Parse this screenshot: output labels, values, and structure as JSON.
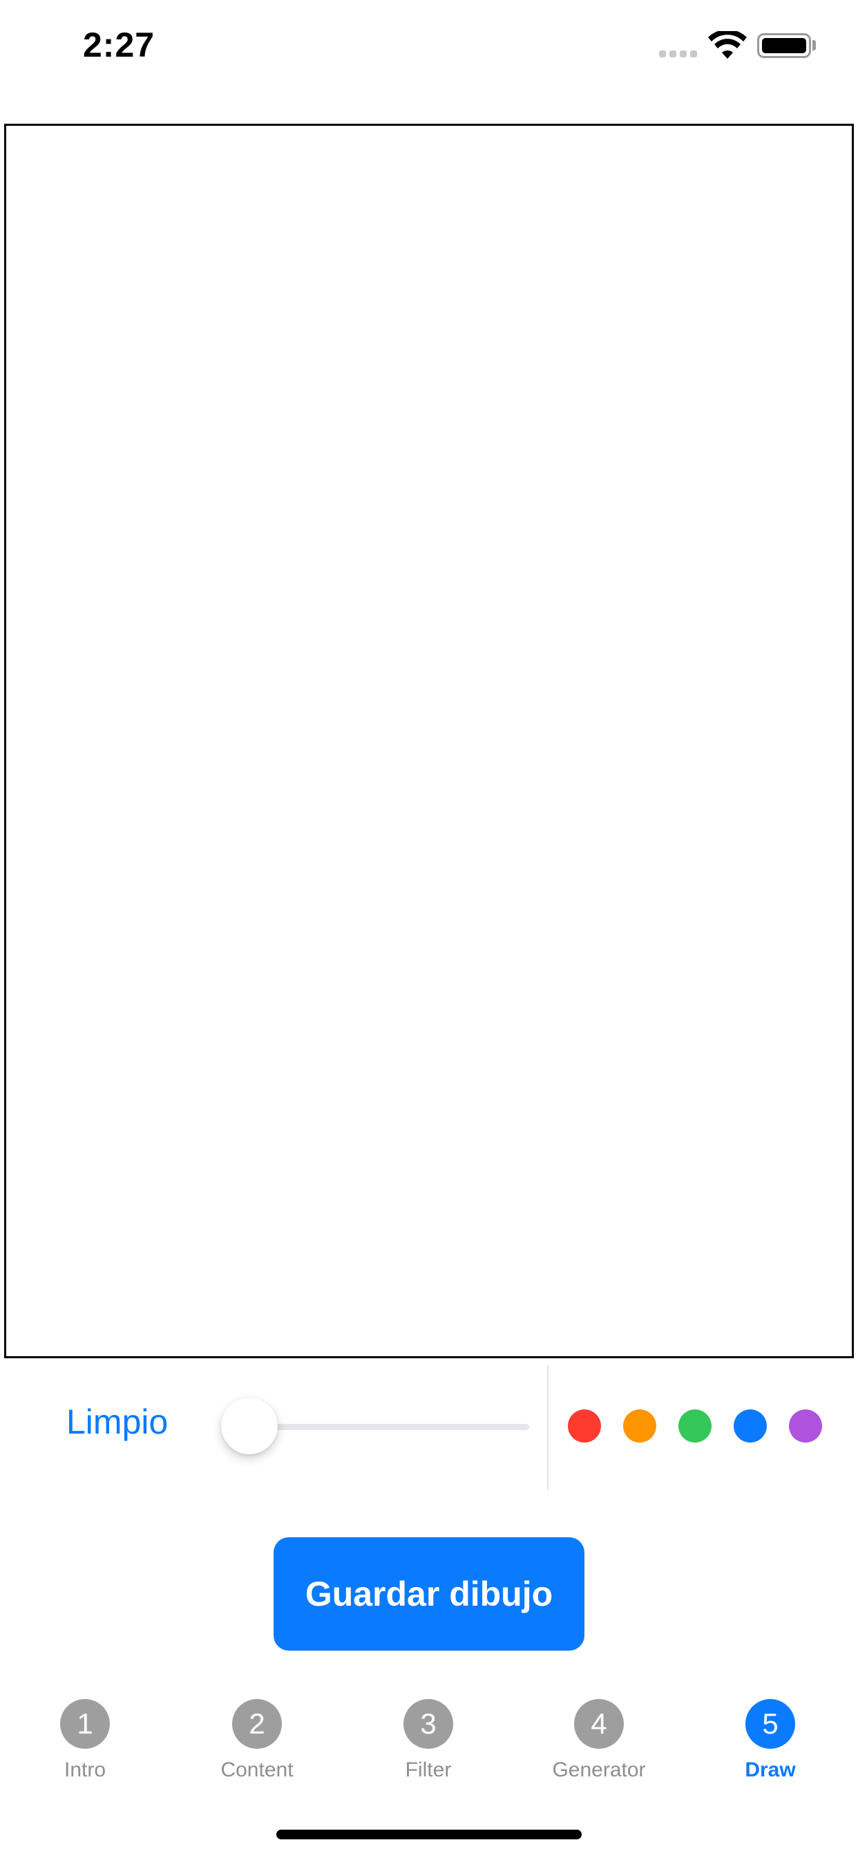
{
  "status_bar": {
    "time": "2:27",
    "signal_icon": "cellular-signal-icon",
    "wifi_icon": "wifi-icon",
    "battery_icon": "battery-icon",
    "battery_level": 1.0
  },
  "controls": {
    "clear_label": "Limpio",
    "brush_size": 0.0,
    "colors": [
      {
        "name": "red",
        "hex": "#ff3b30"
      },
      {
        "name": "orange",
        "hex": "#ff9500"
      },
      {
        "name": "green",
        "hex": "#34c759"
      },
      {
        "name": "blue",
        "hex": "#0a7aff"
      },
      {
        "name": "purple",
        "hex": "#af52de"
      }
    ]
  },
  "save_button": {
    "label": "Guardar dibujo"
  },
  "tabs": [
    {
      "number": "1",
      "label": "Intro",
      "active": false
    },
    {
      "number": "2",
      "label": "Content",
      "active": false
    },
    {
      "number": "3",
      "label": "Filter",
      "active": false
    },
    {
      "number": "4",
      "label": "Generator",
      "active": false
    },
    {
      "number": "5",
      "label": "Draw",
      "active": true
    }
  ],
  "theme": {
    "accent": "#0a7aff",
    "inactive_badge": "#9e9e9e",
    "inactive_label": "#8e8e93"
  }
}
